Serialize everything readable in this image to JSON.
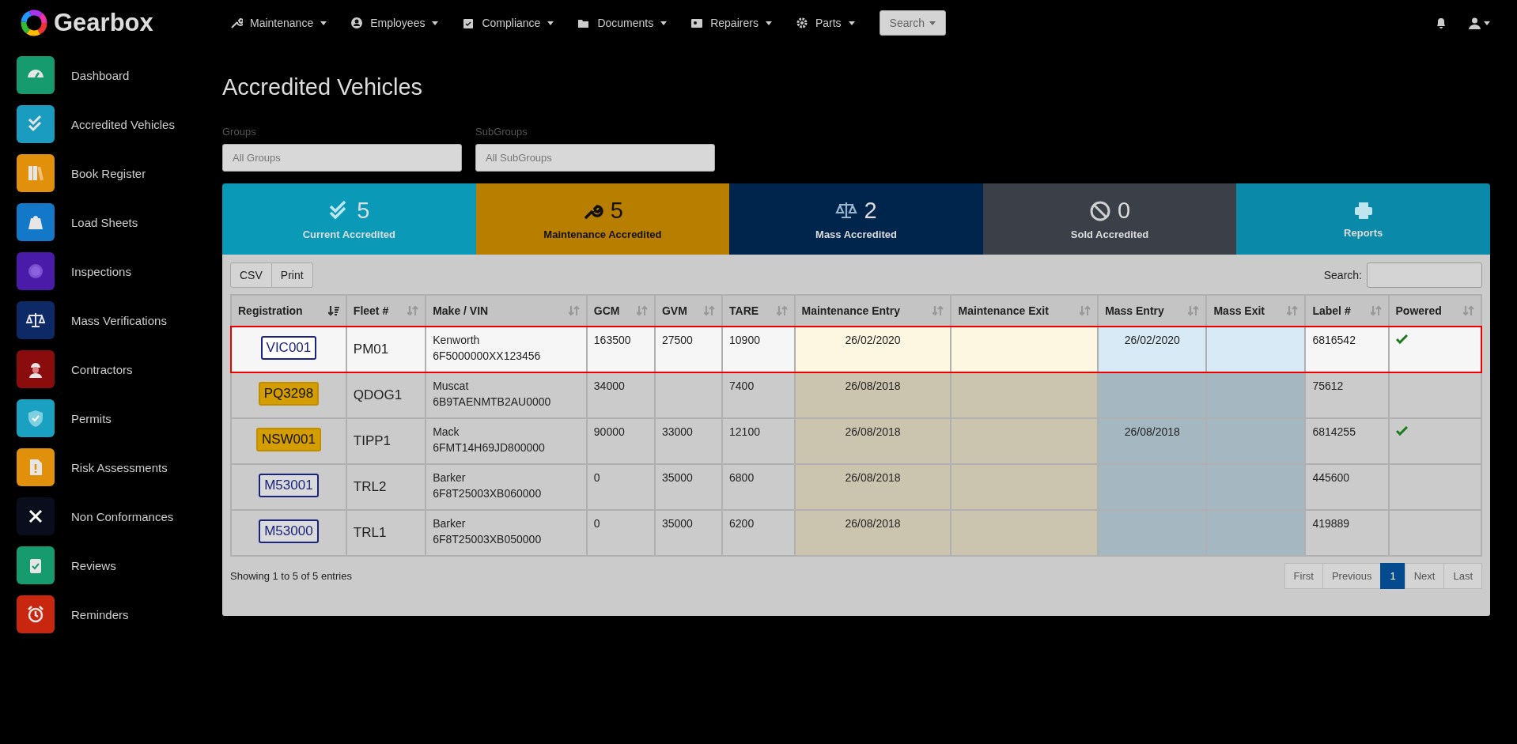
{
  "brand": "Gearbox",
  "nav": [
    "Maintenance",
    "Employees",
    "Compliance",
    "Documents",
    "Repairers",
    "Parts"
  ],
  "nav_search": "Search",
  "sidebar": [
    {
      "label": "Dashboard",
      "color": "#169b6e"
    },
    {
      "label": "Accredited Vehicles",
      "color": "#1a9cc0"
    },
    {
      "label": "Book Register",
      "color": "#e0900a"
    },
    {
      "label": "Load Sheets",
      "color": "#1478c8"
    },
    {
      "label": "Inspections",
      "color": "#4a1aa8"
    },
    {
      "label": "Mass Verifications",
      "color": "#0d2a66"
    },
    {
      "label": "Contractors",
      "color": "#8a0c0c"
    },
    {
      "label": "Permits",
      "color": "#1aa0c0"
    },
    {
      "label": "Risk Assessments",
      "color": "#e0900a"
    },
    {
      "label": "Non Conformances",
      "color": "#0a0e1c"
    },
    {
      "label": "Reviews",
      "color": "#169b6e"
    },
    {
      "label": "Reminders",
      "color": "#c8260e"
    }
  ],
  "title": "Accredited Vehicles",
  "filters": [
    {
      "label": "Groups",
      "placeholder": "All Groups"
    },
    {
      "label": "SubGroups",
      "placeholder": "All SubGroups"
    }
  ],
  "stats": [
    {
      "count": "5",
      "label": "Current Accredited",
      "color": "#0a9ab8",
      "selected": false
    },
    {
      "count": "5",
      "label": "Maintenance Accredited",
      "color": "#b87e00",
      "selected": true
    },
    {
      "count": "2",
      "label": "Mass Accredited",
      "color": "#00254d",
      "selected": false
    },
    {
      "count": "0",
      "label": "Sold Accredited",
      "color": "#3a3f48",
      "selected": false
    },
    {
      "label": "Reports",
      "color": "#0a8aa8",
      "selected": false
    }
  ],
  "toolbar_buttons": [
    "CSV",
    "Print"
  ],
  "search_label": "Search:",
  "table": {
    "columns": [
      {
        "label": "Registration",
        "sorted": true,
        "kind": "plain"
      },
      {
        "label": "Fleet #",
        "sorted": false,
        "kind": "plain"
      },
      {
        "label": "Make / VIN",
        "sorted": false,
        "kind": "plain"
      },
      {
        "label": "GCM",
        "sorted": false,
        "kind": "plain"
      },
      {
        "label": "GVM",
        "sorted": false,
        "kind": "plain"
      },
      {
        "label": "TARE",
        "sorted": false,
        "kind": "plain"
      },
      {
        "label": "Maintenance Entry",
        "sorted": false,
        "kind": "maintenance"
      },
      {
        "label": "Maintenance Exit",
        "sorted": false,
        "kind": "maintenance"
      },
      {
        "label": "Mass Entry",
        "sorted": false,
        "kind": "mass"
      },
      {
        "label": "Mass Exit",
        "sorted": false,
        "kind": "mass"
      },
      {
        "label": "Label #",
        "sorted": false,
        "kind": "plain"
      },
      {
        "label": "Powered",
        "sorted": false,
        "kind": "plain"
      }
    ],
    "rows": [
      {
        "selected": true,
        "plate": {
          "text": "VIC001",
          "kind": "outline"
        },
        "fleet": "PM01",
        "make": "Kenworth",
        "vin": "6F5000000XX123456",
        "gcm": "163500",
        "gvm": "27500",
        "tare": "10900",
        "maint_entry": "26/02/2020",
        "mass_entry": "26/02/2020",
        "label_no": "6816542",
        "powered": true
      },
      {
        "selected": false,
        "plate": {
          "text": "PQ3298",
          "kind": "filled"
        },
        "fleet": "QDOG1",
        "make": "Muscat",
        "vin": "6B9TAENMTB2AU0000",
        "gcm": "34000",
        "tare": "7400",
        "maint_entry": "26/08/2018",
        "label_no": "75612",
        "powered": false
      },
      {
        "selected": false,
        "plate": {
          "text": "NSW001",
          "kind": "filled"
        },
        "fleet": "TIPP1",
        "make": "Mack",
        "vin": "6FMT14H69JD800000",
        "gcm": "90000",
        "gvm": "33000",
        "tare": "12100",
        "maint_entry": "26/08/2018",
        "mass_entry": "26/08/2018",
        "label_no": "6814255",
        "powered": true
      },
      {
        "selected": false,
        "plate": {
          "text": "M53001",
          "kind": "outline"
        },
        "fleet": "TRL2",
        "make": "Barker",
        "vin": "6F8T25003XB060000",
        "gcm": "0",
        "gvm": "35000",
        "tare": "6800",
        "maint_entry": "26/08/2018",
        "label_no": "445600",
        "powered": false
      },
      {
        "selected": false,
        "plate": {
          "text": "M53000",
          "kind": "outline"
        },
        "fleet": "TRL1",
        "make": "Barker",
        "vin": "6F8T25003XB050000",
        "gcm": "0",
        "gvm": "35000",
        "tare": "6200",
        "maint_entry": "26/08/2018",
        "label_no": "419889",
        "powered": false
      }
    ]
  },
  "info": "Showing 1 to 5 of 5 entries",
  "pagination": [
    {
      "label": "First",
      "selected": false
    },
    {
      "label": "Previous",
      "selected": false
    },
    {
      "label": "1",
      "selected": true
    },
    {
      "label": "Next",
      "selected": false
    },
    {
      "label": "Last",
      "selected": false
    }
  ]
}
